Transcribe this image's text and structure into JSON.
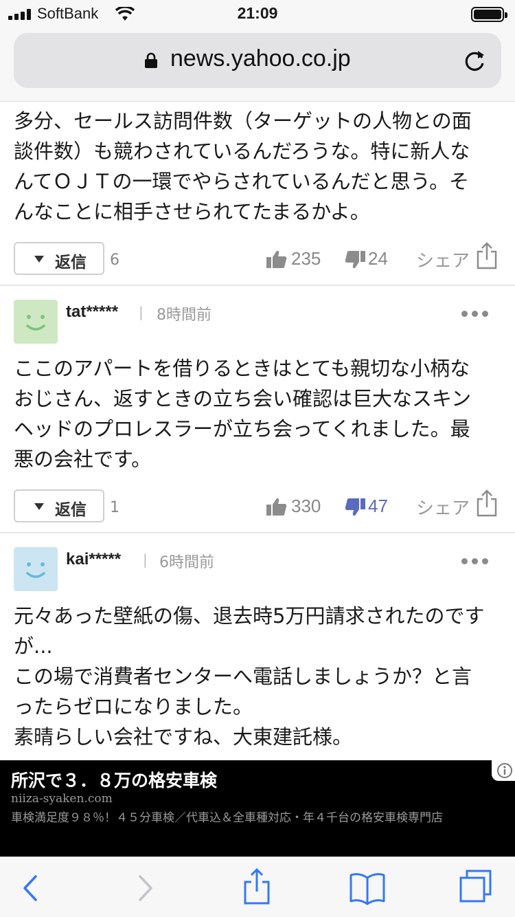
{
  "status_bar": {
    "carrier": "SoftBank",
    "time": "21:09"
  },
  "browser": {
    "url": "news.yahoo.co.jp"
  },
  "comments": [
    {
      "text": "多分、セールス訪問件数（ターゲットの人物との面\n談件数）も競わされているんだろうな。特に新人な\nんてＯＪＴの一環でやらされているんだと思う。そ\nんなことに相手させられてたまるかよ。",
      "reply_label": "返信",
      "reply_count": "6",
      "likes": "235",
      "dislikes": "24",
      "share_label": "シェア"
    },
    {
      "user": "tat*****",
      "separator": "|",
      "time_ago": "8時間前",
      "avatar_color": "#cfe8c4",
      "text": "ここのアパートを借りるときはとても親切な小柄な\nおじさん、返すときの立ち会い確認は巨大なスキン\nヘッドのプロレスラーが立ち会ってくれました。最\n悪の会社です。",
      "reply_label": "返信",
      "reply_count": "1",
      "likes": "330",
      "dislikes": "47",
      "share_label": "シェア"
    },
    {
      "user": "kai*****",
      "separator": "|",
      "time_ago": "6時間前",
      "avatar_color": "#cbe6f2",
      "text": "元々あった壁紙の傷、退去時5万円請求されたのです\nが...\nこの場で消費者センターへ電話しましょうか？と言\nったらゼロになりました。\n素晴らしい会社ですね、大東建託様。"
    }
  ],
  "ad": {
    "title": "所沢で３．８万の格安車検",
    "domain": "niiza-syaken.com",
    "description": "車検満足度９８％！４５分車検／代車込＆全車種対応・年４千台の格安車検専門店"
  },
  "toolbar": {
    "icons": [
      "back-icon",
      "forward-icon",
      "share-icon",
      "bookmarks-icon",
      "tabs-icon"
    ]
  },
  "colors": {
    "accent": "#3478f6",
    "dislike_active": "#5a6bbf"
  }
}
